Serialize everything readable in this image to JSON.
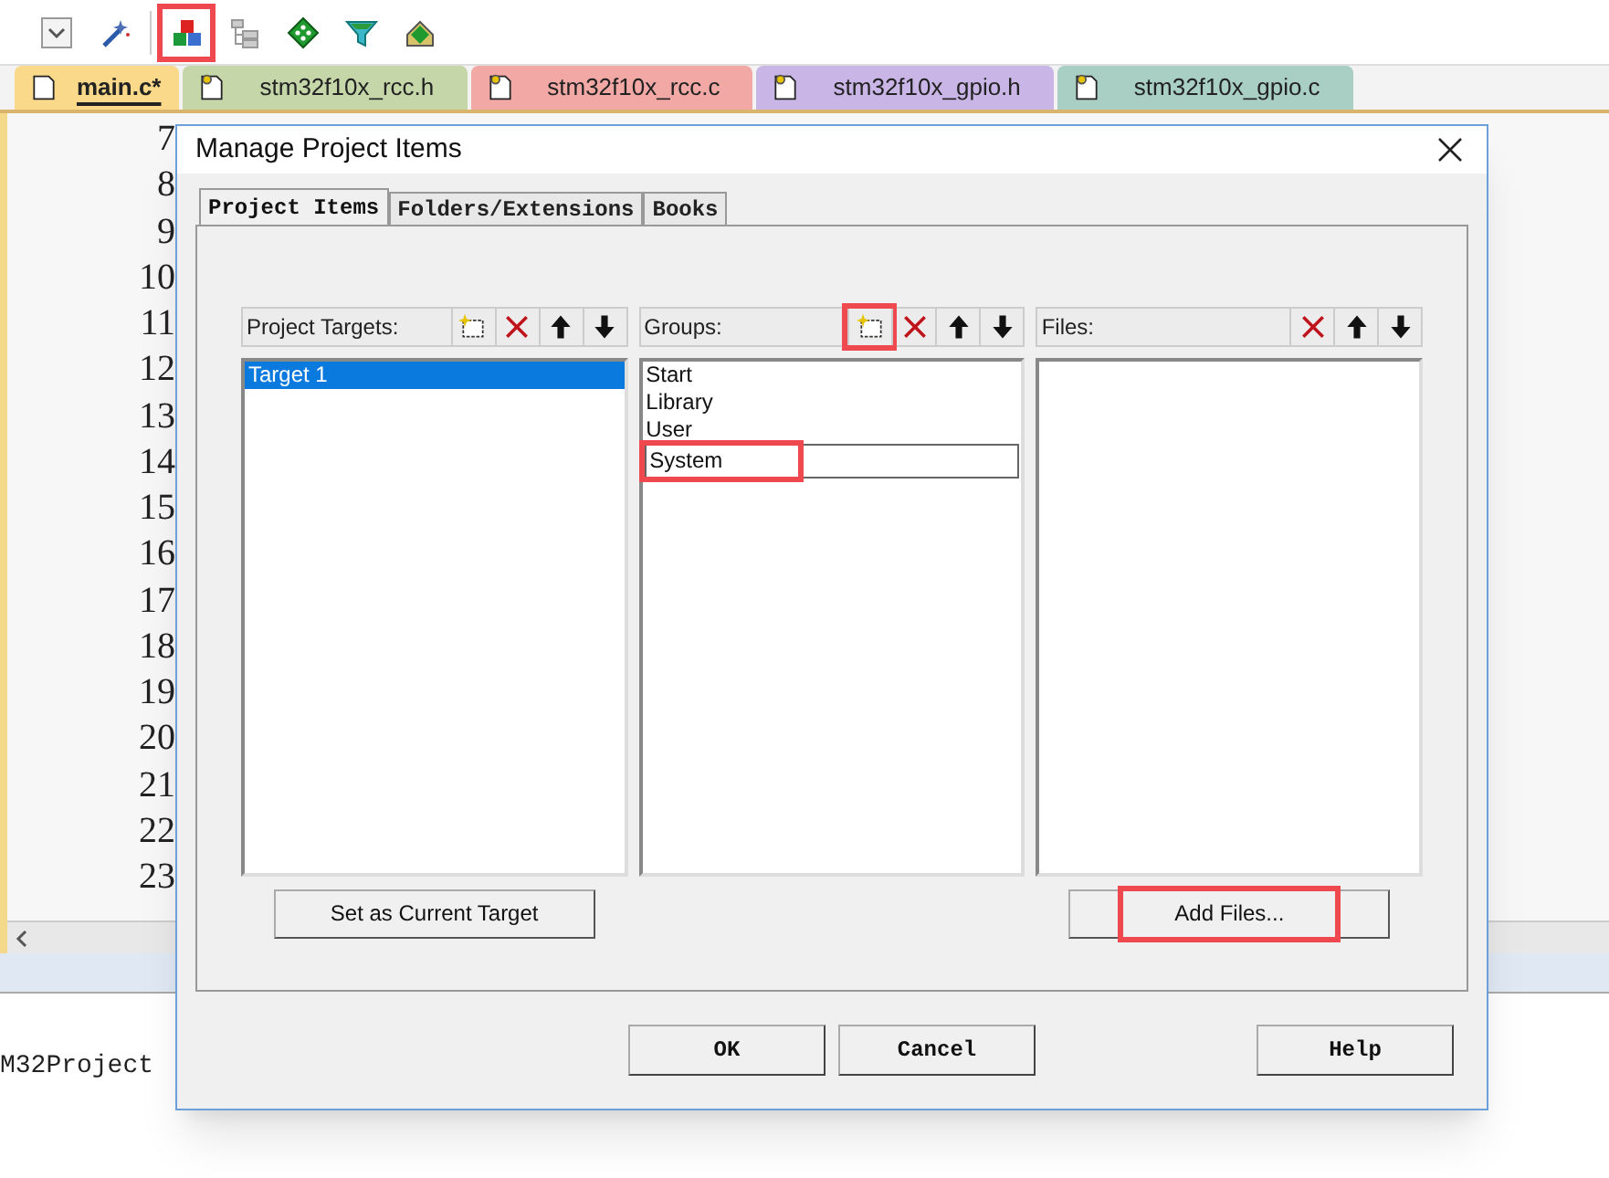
{
  "toolbar": {
    "items": [
      {
        "kind": "dropdown",
        "highlighted": false
      },
      {
        "kind": "wand",
        "highlighted": false
      },
      {
        "kind": "blocks",
        "highlighted": true
      },
      {
        "kind": "tree",
        "highlighted": false
      },
      {
        "kind": "diamond",
        "highlighted": false
      },
      {
        "kind": "funnel",
        "highlighted": false
      },
      {
        "kind": "stack",
        "highlighted": false
      }
    ]
  },
  "file_tabs": [
    {
      "label": "main.c*",
      "selected": true,
      "color": "#fbd98a"
    },
    {
      "label": "stm32f10x_rcc.h",
      "selected": false,
      "color": "#c5d6a8"
    },
    {
      "label": "stm32f10x_rcc.c",
      "selected": false,
      "color": "#f2a9a6"
    },
    {
      "label": "stm32f10x_gpio.h",
      "selected": false,
      "color": "#c9b5e6"
    },
    {
      "label": "stm32f10x_gpio.c",
      "selected": false,
      "color": "#a9cfc4"
    }
  ],
  "editor": {
    "line_numbers": [
      "7",
      "8",
      "9",
      "10",
      "11",
      "12",
      "13",
      "14",
      "15",
      "16",
      "17",
      "18",
      "19",
      "20",
      "21",
      "22",
      "23"
    ]
  },
  "output": {
    "text": "M32Project"
  },
  "dialog": {
    "title": "Manage Project Items",
    "tabs": [
      {
        "label": "Project Items",
        "selected": true
      },
      {
        "label": "Folders/Extensions",
        "selected": false
      },
      {
        "label": "Books",
        "selected": false
      }
    ],
    "panels": [
      {
        "label": "Project Targets:",
        "tools": [
          {
            "kind": "new",
            "highlighted": false
          },
          {
            "kind": "delete",
            "highlighted": false
          },
          {
            "kind": "up",
            "highlighted": false
          },
          {
            "kind": "down",
            "highlighted": false
          }
        ],
        "items": [
          {
            "text": "Target 1",
            "kind": "item",
            "selected": true,
            "highlighted": false
          }
        ],
        "button": {
          "label": "Set as Current Target",
          "highlighted": false
        }
      },
      {
        "label": "Groups:",
        "tools": [
          {
            "kind": "new",
            "highlighted": true
          },
          {
            "kind": "delete",
            "highlighted": false
          },
          {
            "kind": "up",
            "highlighted": false
          },
          {
            "kind": "down",
            "highlighted": false
          }
        ],
        "items": [
          {
            "text": "Start",
            "kind": "item",
            "selected": false,
            "highlighted": false
          },
          {
            "text": "Library",
            "kind": "item",
            "selected": false,
            "highlighted": false
          },
          {
            "text": "User",
            "kind": "item",
            "selected": false,
            "highlighted": false
          },
          {
            "text": "System",
            "kind": "editing",
            "selected": false,
            "highlighted": true
          }
        ]
      },
      {
        "label": "Files:",
        "tools": [
          {
            "kind": "delete",
            "highlighted": false
          },
          {
            "kind": "up",
            "highlighted": false
          },
          {
            "kind": "down",
            "highlighted": false
          }
        ],
        "button": {
          "label": "Add Files...",
          "highlighted": true
        }
      }
    ],
    "buttons": [
      "OK",
      "Cancel",
      "Help"
    ]
  }
}
